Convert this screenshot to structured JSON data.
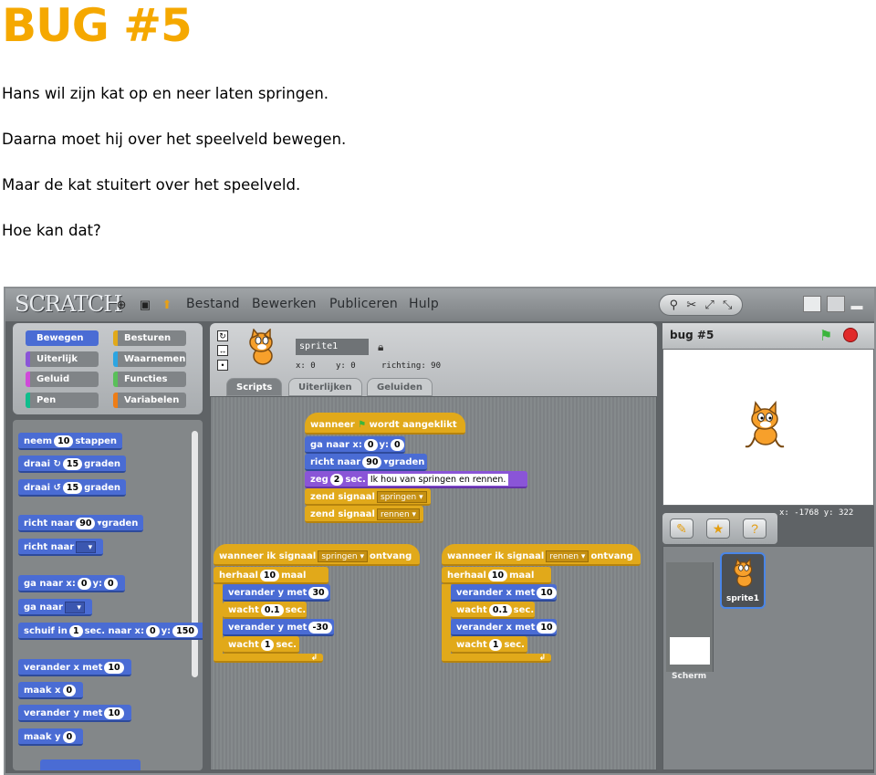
{
  "document": {
    "title": "BUG #5",
    "lines": [
      "Hans wil zijn kat op en neer laten springen.",
      "Daarna moet hij over het speelveld bewegen.",
      "Maar de kat stuitert over het speelveld.",
      "Hoe kan dat?"
    ]
  },
  "app": {
    "logo": "SCRATCH",
    "menu": [
      "Bestand",
      "Bewerken",
      "Publiceren",
      "Hulp"
    ]
  },
  "categories": [
    {
      "label": "Bewegen",
      "color": "#4a6cd4"
    },
    {
      "label": "Besturen",
      "color": "#e1a91a"
    },
    {
      "label": "Uiterlijk",
      "color": "#8a55d7"
    },
    {
      "label": "Waarnemen",
      "color": "#2ca5e2"
    },
    {
      "label": "Geluid",
      "color": "#cf4ad9"
    },
    {
      "label": "Functies",
      "color": "#59c059"
    },
    {
      "label": "Pen",
      "color": "#0fbd8c"
    },
    {
      "label": "Variabelen",
      "color": "#ee7d16"
    }
  ],
  "palette": {
    "neem": "neem",
    "neem_val": "10",
    "stappen": "stappen",
    "draai": "draai",
    "draai_cw_val": "15",
    "draai_ccw_val": "15",
    "graden": "graden",
    "richt_naar": "richt naar",
    "richt_val": "90",
    "ga_naar_x": "ga naar x:",
    "gx_val": "0",
    "y": "y:",
    "gy_val": "0",
    "ga_naar": "ga naar",
    "schuif_in": "schuif in",
    "schuif_val": "1",
    "sec_naar_x": "sec. naar x:",
    "sx_val": "0",
    "sy_val": "150",
    "verander_x": "verander x met",
    "vx_val": "10",
    "maak_x": "maak x",
    "mx_val": "0",
    "verander_y": "verander y met",
    "vy_val": "10",
    "maak_y": "maak y",
    "my_val": "0"
  },
  "sprite_info": {
    "name": "sprite1",
    "x_label": "x: 0",
    "y_label": "y: 0",
    "richting_label": "richting: 90"
  },
  "tabs": [
    "Scripts",
    "Uiterlijken",
    "Geluiden"
  ],
  "script1": {
    "wanneer": "wanneer",
    "aangeklikt": "wordt aangeklikt",
    "ga_naar": "ga naar x:",
    "x": "0",
    "y_label": "y:",
    "y": "0",
    "richt": "richt naar",
    "richt_val": "90",
    "graden": "graden",
    "zeg": "zeg",
    "zeg_n": "2",
    "sec": "sec.",
    "zeg_text": "Ik hou van springen en rennen.",
    "zend1": "zend signaal",
    "zend1_val": "springen",
    "zend2": "zend signaal",
    "zend2_val": "rennen"
  },
  "script2": {
    "wanneer": "wanneer ik signaal",
    "signal": "springen",
    "ontvang": "ontvang",
    "herhaal": "herhaal",
    "herhaal_val": "10",
    "maal": "maal",
    "vy1": "verander y met",
    "vy1_val": "30",
    "wacht1": "wacht",
    "wacht1_val": "0.1",
    "sec": "sec.",
    "vy2": "verander y met",
    "vy2_val": "-30",
    "wacht2": "wacht",
    "wacht2_val": "1"
  },
  "script3": {
    "wanneer": "wanneer ik signaal",
    "signal": "rennen",
    "ontvang": "ontvang",
    "herhaal": "herhaal",
    "herhaal_val": "10",
    "maal": "maal",
    "vx1": "verander x met",
    "vx1_val": "10",
    "wacht1": "wacht",
    "wacht1_val": "0.1",
    "sec": "sec.",
    "vx2": "verander x met",
    "vx2_val": "10",
    "wacht2": "wacht",
    "wacht2_val": "1"
  },
  "stage": {
    "title": "bug #5",
    "mouse_coords": "x: -1768  y: 322"
  },
  "sprites": {
    "sprite_label": "sprite1",
    "stage_label": "Scherm"
  }
}
